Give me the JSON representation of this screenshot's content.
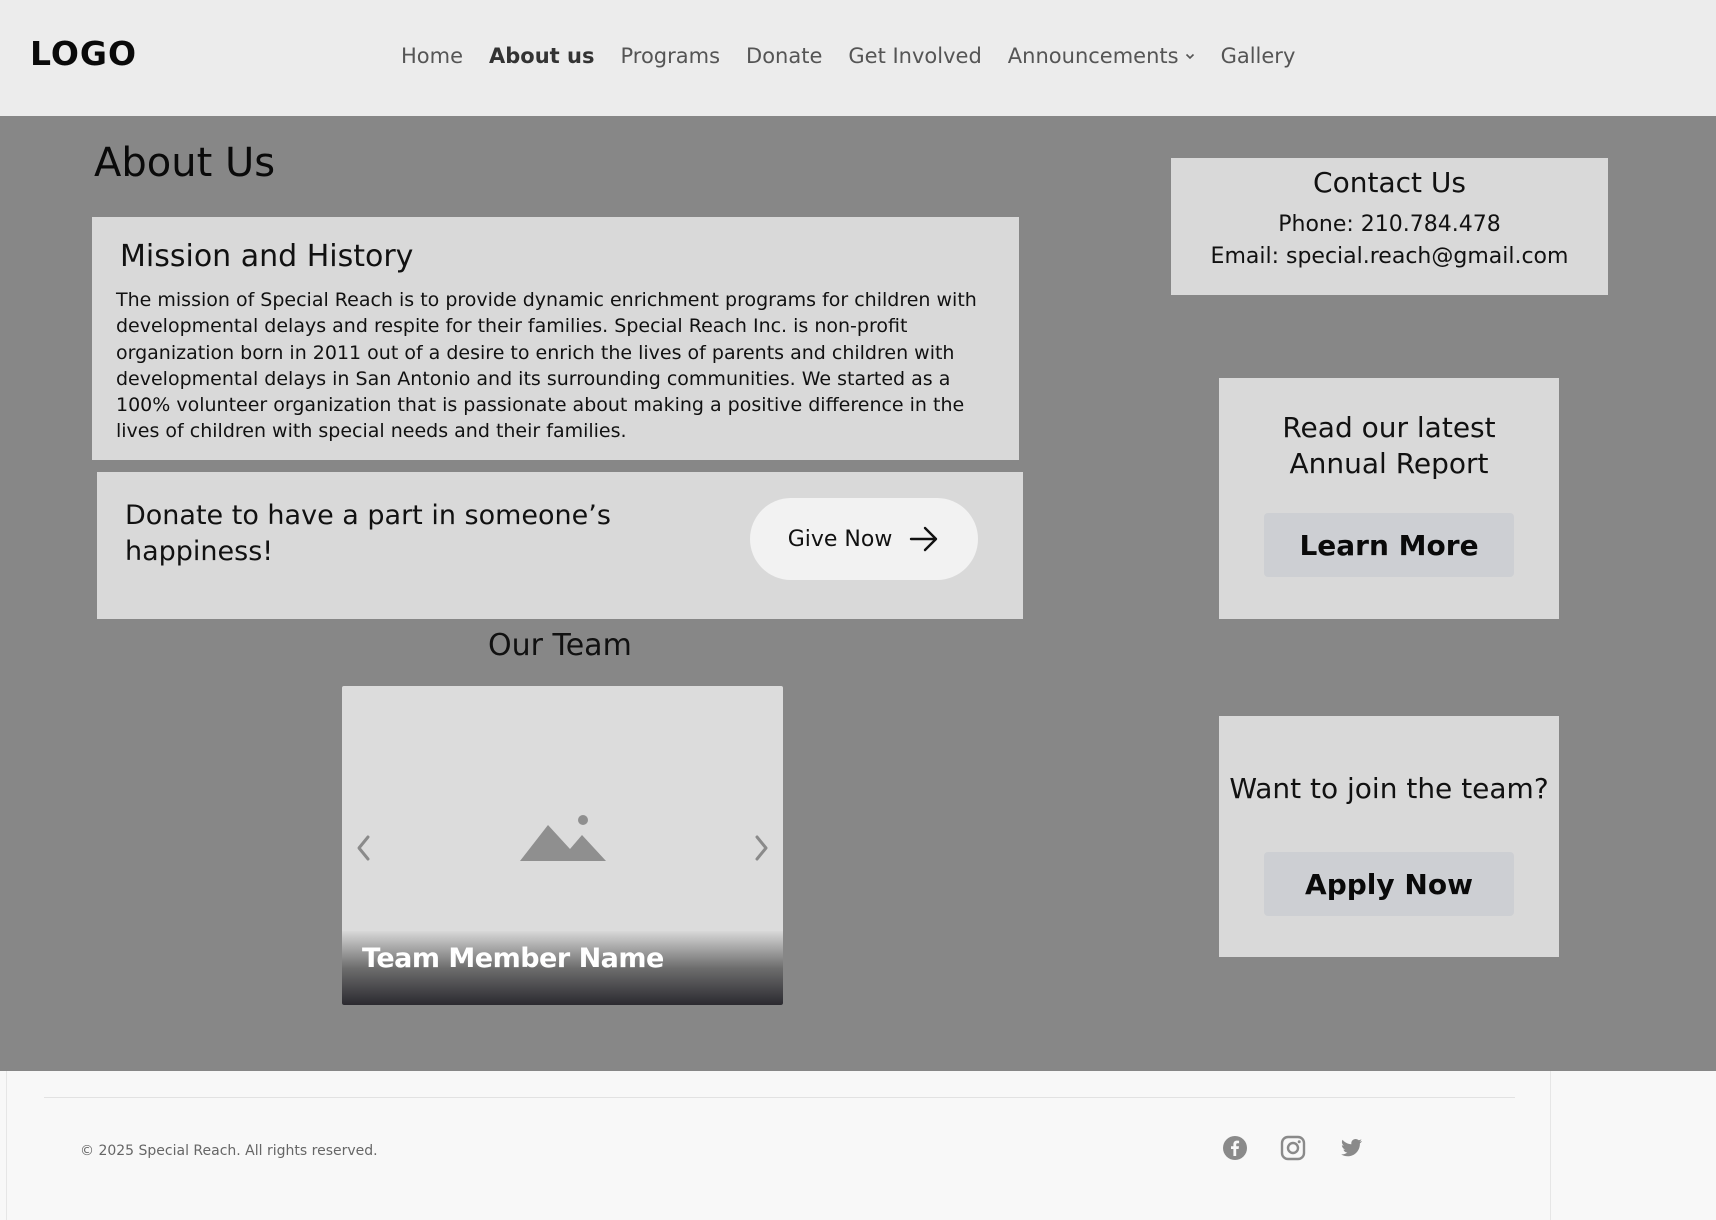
{
  "header": {
    "logo": "LOGO",
    "nav": [
      {
        "label": "Home",
        "active": false
      },
      {
        "label": "About us",
        "active": true
      },
      {
        "label": "Programs",
        "active": false
      },
      {
        "label": "Donate",
        "active": false
      },
      {
        "label": "Get Involved",
        "active": false
      },
      {
        "label": "Announcements",
        "active": false,
        "dropdown": true
      },
      {
        "label": "Gallery",
        "active": false
      }
    ]
  },
  "main": {
    "title": "About Us",
    "mission": {
      "heading": "Mission and History",
      "body": "The mission of Special Reach is to provide dynamic enrichment programs for children with developmental delays and respite for their families. Special Reach Inc. is non-profit organization born in 2011 out of a desire to enrich the lives of parents and children with developmental delays in San Antonio and its surrounding communities. We started as a 100% volunteer organization that is passionate about making a positive difference in the lives of children with special needs and their families."
    },
    "donate": {
      "text": "Donate to have a part in someone’s happiness!",
      "button_label": "Give Now"
    },
    "team": {
      "title": "Our Team",
      "member_caption": "Team Member  Name"
    }
  },
  "sidebar": {
    "contact": {
      "heading": "Contact Us",
      "phone": "Phone: 210.784.478",
      "email": "Email: special.reach@gmail.com"
    },
    "report": {
      "text_line1": "Read our latest",
      "text_line2": "Annual Report",
      "button_label": "Learn More"
    },
    "join": {
      "text": "Want to join the team?",
      "button_label": "Apply Now"
    }
  },
  "footer": {
    "copyright": "© 2025 Special Reach. All rights reserved.",
    "socials": [
      "facebook-icon",
      "instagram-icon",
      "twitter-icon"
    ]
  },
  "colors": {
    "header_bg": "#ececec",
    "main_bg": "#878787",
    "card_bg": "#d9d9d9",
    "footer_bg": "#f8f8f8",
    "icon_gray": "#8a8a8a"
  }
}
